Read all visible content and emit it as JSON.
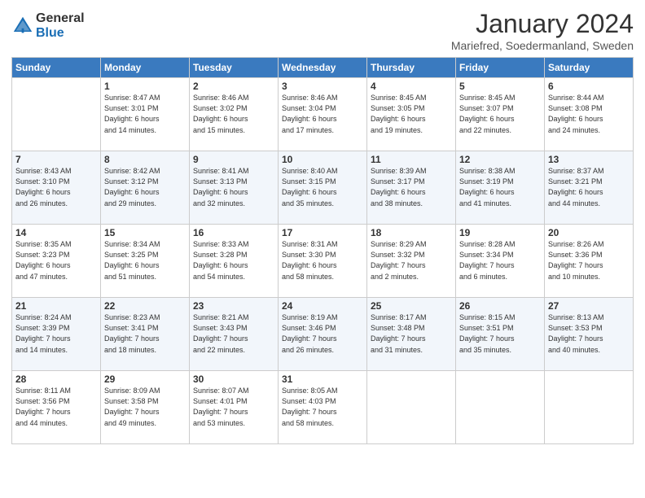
{
  "logo": {
    "line1": "General",
    "line2": "Blue"
  },
  "title": "January 2024",
  "location": "Mariefred, Soedermanland, Sweden",
  "days_of_week": [
    "Sunday",
    "Monday",
    "Tuesday",
    "Wednesday",
    "Thursday",
    "Friday",
    "Saturday"
  ],
  "weeks": [
    [
      {
        "num": "",
        "info": ""
      },
      {
        "num": "1",
        "info": "Sunrise: 8:47 AM\nSunset: 3:01 PM\nDaylight: 6 hours\nand 14 minutes."
      },
      {
        "num": "2",
        "info": "Sunrise: 8:46 AM\nSunset: 3:02 PM\nDaylight: 6 hours\nand 15 minutes."
      },
      {
        "num": "3",
        "info": "Sunrise: 8:46 AM\nSunset: 3:04 PM\nDaylight: 6 hours\nand 17 minutes."
      },
      {
        "num": "4",
        "info": "Sunrise: 8:45 AM\nSunset: 3:05 PM\nDaylight: 6 hours\nand 19 minutes."
      },
      {
        "num": "5",
        "info": "Sunrise: 8:45 AM\nSunset: 3:07 PM\nDaylight: 6 hours\nand 22 minutes."
      },
      {
        "num": "6",
        "info": "Sunrise: 8:44 AM\nSunset: 3:08 PM\nDaylight: 6 hours\nand 24 minutes."
      }
    ],
    [
      {
        "num": "7",
        "info": "Sunrise: 8:43 AM\nSunset: 3:10 PM\nDaylight: 6 hours\nand 26 minutes."
      },
      {
        "num": "8",
        "info": "Sunrise: 8:42 AM\nSunset: 3:12 PM\nDaylight: 6 hours\nand 29 minutes."
      },
      {
        "num": "9",
        "info": "Sunrise: 8:41 AM\nSunset: 3:13 PM\nDaylight: 6 hours\nand 32 minutes."
      },
      {
        "num": "10",
        "info": "Sunrise: 8:40 AM\nSunset: 3:15 PM\nDaylight: 6 hours\nand 35 minutes."
      },
      {
        "num": "11",
        "info": "Sunrise: 8:39 AM\nSunset: 3:17 PM\nDaylight: 6 hours\nand 38 minutes."
      },
      {
        "num": "12",
        "info": "Sunrise: 8:38 AM\nSunset: 3:19 PM\nDaylight: 6 hours\nand 41 minutes."
      },
      {
        "num": "13",
        "info": "Sunrise: 8:37 AM\nSunset: 3:21 PM\nDaylight: 6 hours\nand 44 minutes."
      }
    ],
    [
      {
        "num": "14",
        "info": "Sunrise: 8:35 AM\nSunset: 3:23 PM\nDaylight: 6 hours\nand 47 minutes."
      },
      {
        "num": "15",
        "info": "Sunrise: 8:34 AM\nSunset: 3:25 PM\nDaylight: 6 hours\nand 51 minutes."
      },
      {
        "num": "16",
        "info": "Sunrise: 8:33 AM\nSunset: 3:28 PM\nDaylight: 6 hours\nand 54 minutes."
      },
      {
        "num": "17",
        "info": "Sunrise: 8:31 AM\nSunset: 3:30 PM\nDaylight: 6 hours\nand 58 minutes."
      },
      {
        "num": "18",
        "info": "Sunrise: 8:29 AM\nSunset: 3:32 PM\nDaylight: 7 hours\nand 2 minutes."
      },
      {
        "num": "19",
        "info": "Sunrise: 8:28 AM\nSunset: 3:34 PM\nDaylight: 7 hours\nand 6 minutes."
      },
      {
        "num": "20",
        "info": "Sunrise: 8:26 AM\nSunset: 3:36 PM\nDaylight: 7 hours\nand 10 minutes."
      }
    ],
    [
      {
        "num": "21",
        "info": "Sunrise: 8:24 AM\nSunset: 3:39 PM\nDaylight: 7 hours\nand 14 minutes."
      },
      {
        "num": "22",
        "info": "Sunrise: 8:23 AM\nSunset: 3:41 PM\nDaylight: 7 hours\nand 18 minutes."
      },
      {
        "num": "23",
        "info": "Sunrise: 8:21 AM\nSunset: 3:43 PM\nDaylight: 7 hours\nand 22 minutes."
      },
      {
        "num": "24",
        "info": "Sunrise: 8:19 AM\nSunset: 3:46 PM\nDaylight: 7 hours\nand 26 minutes."
      },
      {
        "num": "25",
        "info": "Sunrise: 8:17 AM\nSunset: 3:48 PM\nDaylight: 7 hours\nand 31 minutes."
      },
      {
        "num": "26",
        "info": "Sunrise: 8:15 AM\nSunset: 3:51 PM\nDaylight: 7 hours\nand 35 minutes."
      },
      {
        "num": "27",
        "info": "Sunrise: 8:13 AM\nSunset: 3:53 PM\nDaylight: 7 hours\nand 40 minutes."
      }
    ],
    [
      {
        "num": "28",
        "info": "Sunrise: 8:11 AM\nSunset: 3:56 PM\nDaylight: 7 hours\nand 44 minutes."
      },
      {
        "num": "29",
        "info": "Sunrise: 8:09 AM\nSunset: 3:58 PM\nDaylight: 7 hours\nand 49 minutes."
      },
      {
        "num": "30",
        "info": "Sunrise: 8:07 AM\nSunset: 4:01 PM\nDaylight: 7 hours\nand 53 minutes."
      },
      {
        "num": "31",
        "info": "Sunrise: 8:05 AM\nSunset: 4:03 PM\nDaylight: 7 hours\nand 58 minutes."
      },
      {
        "num": "",
        "info": ""
      },
      {
        "num": "",
        "info": ""
      },
      {
        "num": "",
        "info": ""
      }
    ]
  ]
}
